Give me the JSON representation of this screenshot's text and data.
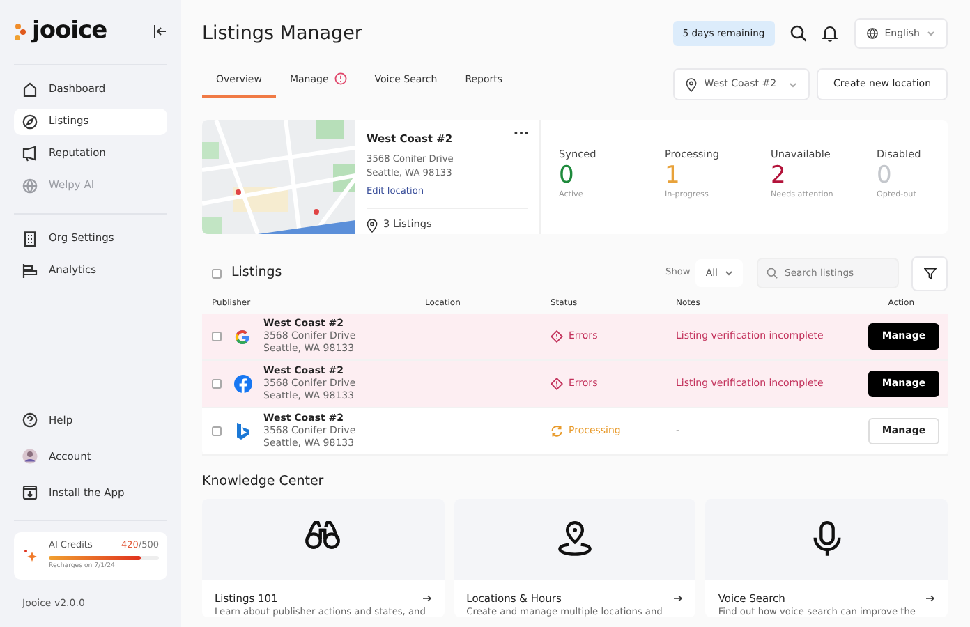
{
  "sidebar": {
    "logo": "jooice",
    "items": [
      {
        "label": "Dashboard",
        "selected": false,
        "disabled": false
      },
      {
        "label": "Listings",
        "selected": true,
        "disabled": false
      },
      {
        "label": "Reputation",
        "selected": false,
        "disabled": false
      },
      {
        "label": "Welpy AI",
        "selected": false,
        "disabled": true
      }
    ],
    "settings_items": [
      {
        "label": "Org Settings",
        "selected": false
      },
      {
        "label": "Analytics",
        "selected": false
      }
    ],
    "bottom_items": [
      {
        "label": "Help"
      },
      {
        "label": "Account"
      },
      {
        "label": "Install the App"
      }
    ],
    "credits": {
      "label": "AI Credits",
      "used": "420",
      "total": "/500",
      "level": 0.84,
      "note": "Recharges on 7/1/24"
    },
    "version": "Jooice v2.0.0"
  },
  "header": {
    "title": "Listings Manager",
    "trial_badge": "5 days remaining",
    "language": "English"
  },
  "tabs": [
    {
      "label": "Overview",
      "selected": true,
      "alert": false
    },
    {
      "label": "Manage",
      "selected": false,
      "alert": true
    },
    {
      "label": "Voice Search",
      "selected": false,
      "alert": false
    },
    {
      "label": "Reports",
      "selected": false,
      "alert": false
    }
  ],
  "location_select": "West Coast #2",
  "create_button": "Create new location",
  "location_card": {
    "name": "West Coast #2",
    "address_line1": "3568 Conifer Drive",
    "address_line2": "Seattle, WA 98133",
    "edit_link": "Edit location",
    "listings_count": "3 Listings",
    "stats": [
      {
        "label": "Synced",
        "value": "0",
        "caption": "Active",
        "color": "#1e8a3c"
      },
      {
        "label": "Processing",
        "value": "1",
        "caption": "In-progress",
        "color": "#e8a23a"
      },
      {
        "label": "Unavailable",
        "value": "2",
        "caption": "Needs attention",
        "color": "#b3133a"
      },
      {
        "label": "Disabled",
        "value": "0",
        "caption": "Opted-out",
        "color": "#c4c7cc"
      }
    ]
  },
  "listings": {
    "title": "Listings",
    "checked": false,
    "show_label": "Show",
    "show_value": "All",
    "search_placeholder": "Search listings",
    "columns": [
      "Publisher",
      "Location",
      "Status",
      "Notes",
      "Action"
    ],
    "rows": [
      {
        "publisher": {
          "kind": "google"
        },
        "checked": false,
        "name": "West Coast #2",
        "address_line1": "3568 Conifer Drive",
        "address_line2": "Seattle, WA 98133",
        "kind": "error",
        "status": "Errors",
        "notes": "Listing verification incomplete",
        "action": "Manage"
      },
      {
        "publisher": {
          "kind": "facebook"
        },
        "checked": false,
        "name": "West Coast #2",
        "address_line1": "3568 Conifer Drive",
        "address_line2": "Seattle, WA 98133",
        "kind": "error",
        "status": "Errors",
        "notes": "Listing verification incomplete",
        "action": "Manage"
      },
      {
        "publisher": {
          "kind": "bing"
        },
        "checked": false,
        "name": "West Coast #2",
        "address_line1": "3568 Conifer Drive",
        "address_line2": "Seattle, WA 98133",
        "kind": "processing",
        "status": "Processing",
        "notes": "-",
        "action": "Manage"
      }
    ]
  },
  "knowledge_center": {
    "title": "Knowledge Center",
    "cards": [
      {
        "title": "Listings 101",
        "description": "Learn about publisher actions and states, and"
      },
      {
        "title": "Locations & Hours",
        "description": "Create and manage multiple locations and"
      },
      {
        "title": "Voice Search",
        "description": "Find out how voice search can improve the"
      }
    ]
  }
}
